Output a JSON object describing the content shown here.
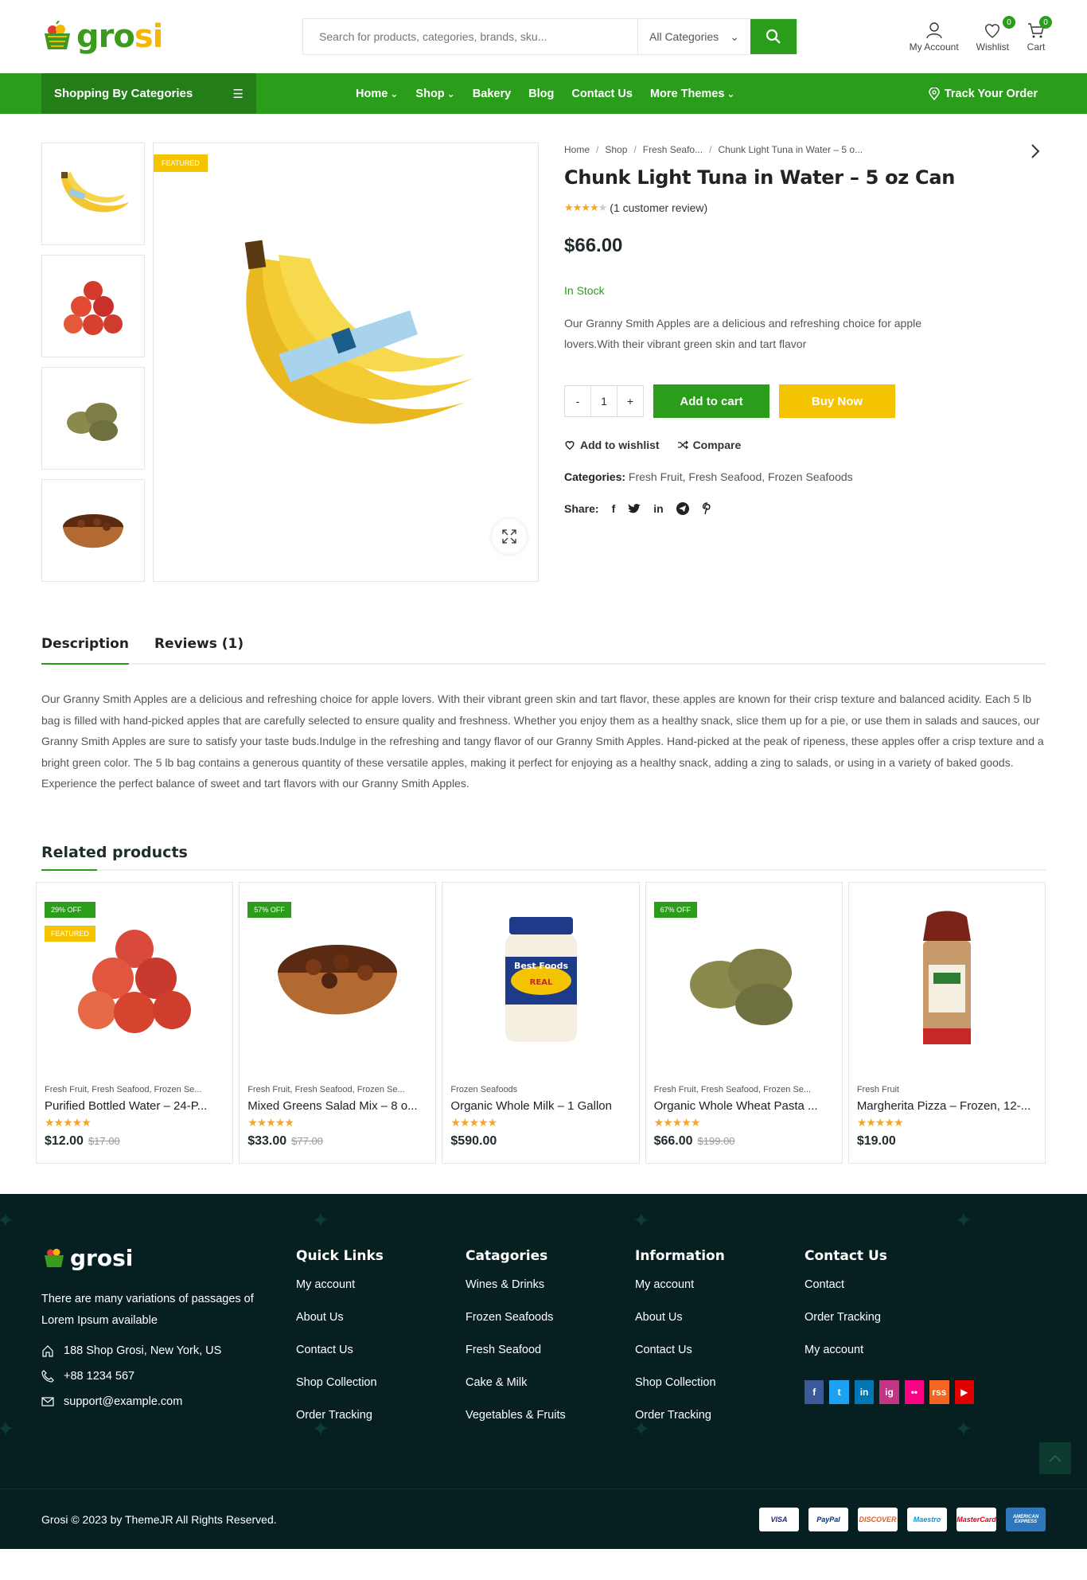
{
  "header": {
    "logo": "grosi",
    "search_placeholder": "Search for products, categories, brands, sku...",
    "search_category": "All Categories",
    "account_label": "My Account",
    "wishlist_label": "Wishlist",
    "wishlist_count": "0",
    "cart_label": "Cart",
    "cart_count": "0"
  },
  "nav": {
    "categories_label": "Shopping By Categories",
    "menu": [
      "Home",
      "Shop",
      "Bakery",
      "Blog",
      "Contact Us",
      "More Themes"
    ],
    "track_label": "Track Your Order"
  },
  "product": {
    "featured_label": "FEATURED",
    "breadcrumb": [
      "Home",
      "Shop",
      "Fresh Seafo...",
      "Chunk Light Tuna in Water – 5 o..."
    ],
    "title": "Chunk Light Tuna in Water – 5 oz Can",
    "rating": 4,
    "rating_max": 5,
    "review_text": "(1 customer review)",
    "price": "$66.00",
    "stock": "In Stock",
    "short_description": "Our Granny Smith Apples are a delicious and refreshing choice for apple lovers.With their vibrant green skin and tart flavor",
    "qty_minus": "-",
    "quantity": "1",
    "qty_plus": "+",
    "add_to_cart": "Add to cart",
    "buy_now": "Buy Now",
    "add_to_wishlist": "Add to wishlist",
    "compare": "Compare",
    "categories_label": "Categories:",
    "categories": [
      "Fresh Fruit",
      "Fresh Seafood",
      "Frozen Seafoods"
    ],
    "share_label": "Share:",
    "share_icons": [
      "facebook-icon",
      "twitter-icon",
      "linkedin-icon",
      "telegram-icon",
      "pinterest-icon"
    ]
  },
  "tabs": {
    "description": "Description",
    "reviews": "Reviews (1)",
    "content": "Our Granny Smith Apples are a delicious and refreshing choice for apple lovers. With their vibrant green skin and tart flavor, these apples are known for their crisp texture and balanced acidity. Each 5 lb bag is filled with hand-picked apples that are carefully selected to ensure quality and freshness. Whether you enjoy them as a healthy snack, slice them up for a pie, or use them in salads and sauces, our Granny Smith Apples are sure to satisfy your taste buds.Indulge in the refreshing and tangy flavor of our Granny Smith Apples. Hand-picked at the peak of ripeness, these apples offer a crisp texture and a bright green color. The 5 lb bag contains a generous quantity of these versatile apples, making it perfect for enjoying as a healthy snack, adding a zing to salads, or using in a variety of baked goods. Experience the perfect balance of sweet and tart flavors with our Granny Smith Apples."
  },
  "related": {
    "title": "Related products",
    "items": [
      {
        "off": "29% OFF",
        "featured": "FEATURED",
        "category": "Fresh Fruit, Fresh Seafood, Frozen Se...",
        "name": "Purified Bottled Water – 24-P...",
        "price": "$12.00",
        "old_price": "$17.00"
      },
      {
        "off": "57% OFF",
        "category": "Fresh Fruit, Fresh Seafood, Frozen Se...",
        "name": "Mixed Greens Salad Mix – 8 o...",
        "price": "$33.00",
        "old_price": "$77.00"
      },
      {
        "category": "Frozen Seafoods",
        "name": "Organic Whole Milk – 1 Gallon",
        "price": "$590.00"
      },
      {
        "off": "67% OFF",
        "category": "Fresh Fruit, Fresh Seafood, Frozen Se...",
        "name": "Organic Whole Wheat Pasta ...",
        "price": "$66.00",
        "old_price": "$199.00"
      },
      {
        "category": "Fresh Fruit",
        "name": "Margherita Pizza – Frozen, 12-...",
        "price": "$19.00"
      }
    ]
  },
  "footer": {
    "logo": "grosi",
    "about": "There are many variations of passages of Lorem Ipsum available",
    "address": "188 Shop Grosi, New York, US",
    "phone": "+88 1234 567",
    "email": "support@example.com",
    "quick_links": {
      "title": "Quick Links",
      "items": [
        "My account",
        "About Us",
        "Contact Us",
        "Shop Collection",
        "Order Tracking"
      ]
    },
    "categories": {
      "title": "Catagories",
      "items": [
        "Wines & Drinks",
        "Frozen Seafoods",
        "Fresh Seafood",
        "Cake & Milk",
        "Vegetables & Fruits"
      ]
    },
    "information": {
      "title": "Information",
      "items": [
        "My account",
        "About Us",
        "Contact Us",
        "Shop Collection",
        "Order Tracking"
      ]
    },
    "contact": {
      "title": "Contact Us",
      "items": [
        "Contact",
        "Order Tracking",
        "My account"
      ]
    },
    "socials": [
      {
        "name": "facebook-icon",
        "label": "f",
        "color": "#3b5998"
      },
      {
        "name": "twitter-icon",
        "label": "t",
        "color": "#1da1f2"
      },
      {
        "name": "linkedin-icon",
        "label": "in",
        "color": "#0077b5"
      },
      {
        "name": "instagram-icon",
        "label": "ig",
        "color": "#c13584"
      },
      {
        "name": "flickr-icon",
        "label": "••",
        "color": "#ff0084"
      },
      {
        "name": "rss-icon",
        "label": "rss",
        "color": "#f26522"
      },
      {
        "name": "youtube-icon",
        "label": "▶",
        "color": "#e00000"
      }
    ],
    "copyright": "Grosi © 2023 by ThemeJR All Rights Reserved.",
    "payments": [
      "VISA",
      "PayPal",
      "DISCOVER",
      "Maestro",
      "MasterCard",
      "AMERICAN EXPRESS"
    ]
  },
  "colors": {
    "brand": "#2a9d1b",
    "accent": "#f5c400",
    "footer_bg": "#062021"
  }
}
